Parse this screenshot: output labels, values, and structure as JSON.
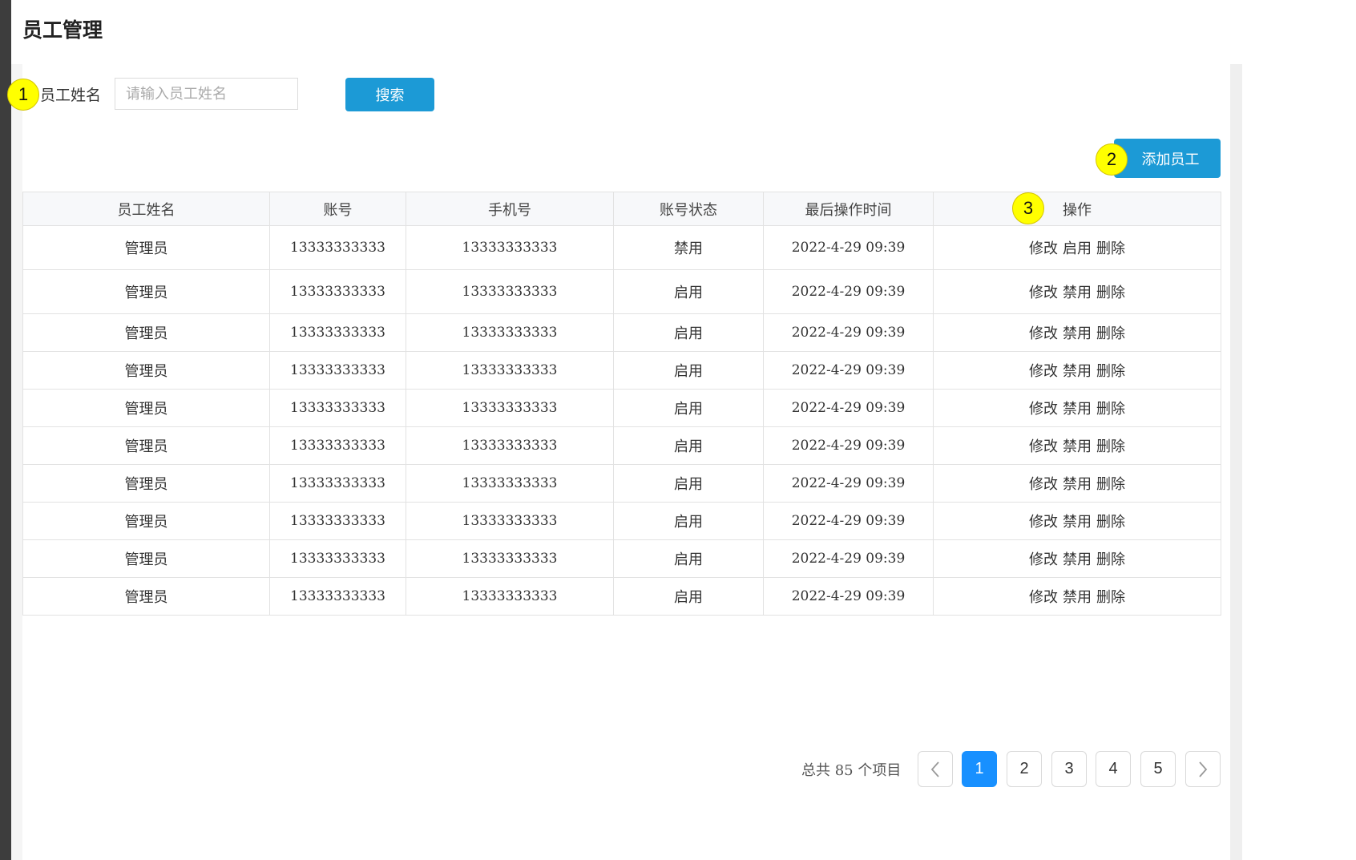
{
  "page": {
    "title": "员工管理"
  },
  "search": {
    "label": "员工姓名",
    "placeholder": "请输入员工姓名",
    "button_label": "搜索"
  },
  "actions": {
    "add_label": "添加员工"
  },
  "markers": [
    "1",
    "2",
    "3"
  ],
  "table": {
    "headers": [
      "员工姓名",
      "账号",
      "手机号",
      "账号状态",
      "最后操作时间",
      "操作"
    ],
    "rows": [
      {
        "name": "管理员",
        "account": "13333333333",
        "phone": "13333333333",
        "status": "禁用",
        "time": "2022-4-29 09:39",
        "ops": [
          "修改",
          "启用",
          "删除"
        ]
      },
      {
        "name": "管理员",
        "account": "13333333333",
        "phone": "13333333333",
        "status": "启用",
        "time": "2022-4-29 09:39",
        "ops": [
          "修改",
          "禁用",
          "删除"
        ]
      },
      {
        "name": "管理员",
        "account": "13333333333",
        "phone": "13333333333",
        "status": "启用",
        "time": "2022-4-29 09:39",
        "ops": [
          "修改",
          "禁用",
          "删除"
        ]
      },
      {
        "name": "管理员",
        "account": "13333333333",
        "phone": "13333333333",
        "status": "启用",
        "time": "2022-4-29 09:39",
        "ops": [
          "修改",
          "禁用",
          "删除"
        ]
      },
      {
        "name": "管理员",
        "account": "13333333333",
        "phone": "13333333333",
        "status": "启用",
        "time": "2022-4-29 09:39",
        "ops": [
          "修改",
          "禁用",
          "删除"
        ]
      },
      {
        "name": "管理员",
        "account": "13333333333",
        "phone": "13333333333",
        "status": "启用",
        "time": "2022-4-29 09:39",
        "ops": [
          "修改",
          "禁用",
          "删除"
        ]
      },
      {
        "name": "管理员",
        "account": "13333333333",
        "phone": "13333333333",
        "status": "启用",
        "time": "2022-4-29 09:39",
        "ops": [
          "修改",
          "禁用",
          "删除"
        ]
      },
      {
        "name": "管理员",
        "account": "13333333333",
        "phone": "13333333333",
        "status": "启用",
        "time": "2022-4-29 09:39",
        "ops": [
          "修改",
          "禁用",
          "删除"
        ]
      },
      {
        "name": "管理员",
        "account": "13333333333",
        "phone": "13333333333",
        "status": "启用",
        "time": "2022-4-29 09:39",
        "ops": [
          "修改",
          "禁用",
          "删除"
        ]
      },
      {
        "name": "管理员",
        "account": "13333333333",
        "phone": "13333333333",
        "status": "启用",
        "time": "2022-4-29 09:39",
        "ops": [
          "修改",
          "禁用",
          "删除"
        ]
      }
    ]
  },
  "pagination": {
    "total_text": "总共 85 个项目",
    "prev_icon": "chevron-left-icon",
    "next_icon": "chevron-right-icon",
    "pages": [
      "1",
      "2",
      "3",
      "4",
      "5"
    ],
    "current": "1"
  },
  "colors": {
    "primary": "#1c9ad6",
    "pager_active": "#1890ff",
    "marker": "#ffff00"
  }
}
